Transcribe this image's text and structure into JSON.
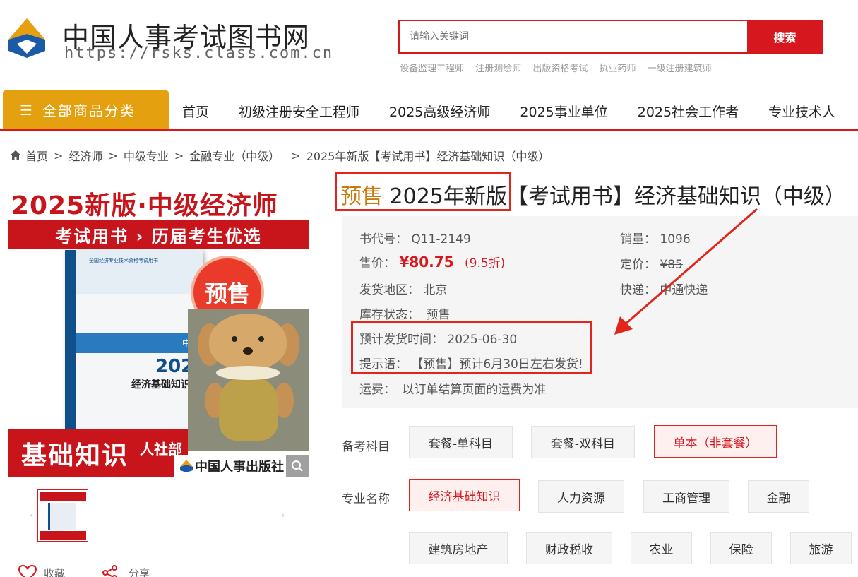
{
  "header": {
    "site_title": "中国人事考试图书网",
    "site_url": "https://rsks.class.com.cn",
    "search_placeholder": "请输入关键词",
    "search_button": "搜索",
    "hot_keywords": [
      "设备监理工程师",
      "注册测绘师",
      "出版资格考试",
      "执业药师",
      "一级注册建筑师"
    ]
  },
  "nav": {
    "all_categories": "全部商品分类",
    "items": [
      "首页",
      "初级注册安全工程师",
      "2025高级经济师",
      "2025事业单位",
      "2025社会工作者",
      "专业技术人"
    ]
  },
  "breadcrumb": [
    "首页",
    "经济师",
    "中级专业",
    "金融专业（中级）",
    "2025年新版【考试用书】经济基础知识（中级）"
  ],
  "product_image": {
    "banner_title": "2025新版·中级经济师",
    "banner_sub": "考试用书 › 历届考生优选",
    "book_series": "全国经济专业技术资格考试用书",
    "book_level": "中级",
    "book_year": "2024",
    "book_title": "经济基础知识",
    "presale_badge": "预售",
    "bottom_label": "基础知识",
    "bottom_label2": "人社部",
    "publisher": "中国人事出版社"
  },
  "actions": {
    "favorite": "收藏",
    "share": "分享"
  },
  "product": {
    "title_presale": "预售",
    "title_edition": "2025年新版",
    "title_rest": "【考试用书】经济基础知识（中级）",
    "book_code_label": "书代号：",
    "book_code": "Q11-2149",
    "sales_label": "销量：",
    "sales": "1096",
    "price_label": "售价：",
    "price": "¥80.75",
    "discount": "(9.5折)",
    "list_price_label": "定价：",
    "list_price": "¥85",
    "ship_from_label": "发货地区：",
    "ship_from": "北京",
    "courier_label": "快递：",
    "courier": "中通快递",
    "stock_label": "库存状态：",
    "stock": "预售",
    "ship_date_label": "预计发货时间：",
    "ship_date": "2025-06-30",
    "tip_label": "提示语：",
    "tip": "【预售】预计6月30日左右发货!",
    "freight_label": "运费：",
    "freight": "以订单结算页面的运费为准"
  },
  "options": {
    "subject_label": "备考科目",
    "subjects": [
      "套餐-单科目",
      "套餐-双科目",
      "单本（非套餐）"
    ],
    "major_label": "专业名称",
    "majors": [
      "经济基础知识",
      "人力资源",
      "工商管理",
      "金融",
      "建筑房地产",
      "财政税收",
      "农业",
      "保险",
      "旅游"
    ]
  },
  "colors": {
    "brand_red": "#d7171e",
    "nav_gold": "#e4a00e",
    "presale_orange": "#c87b0b",
    "annotation_red": "#e1251b"
  }
}
